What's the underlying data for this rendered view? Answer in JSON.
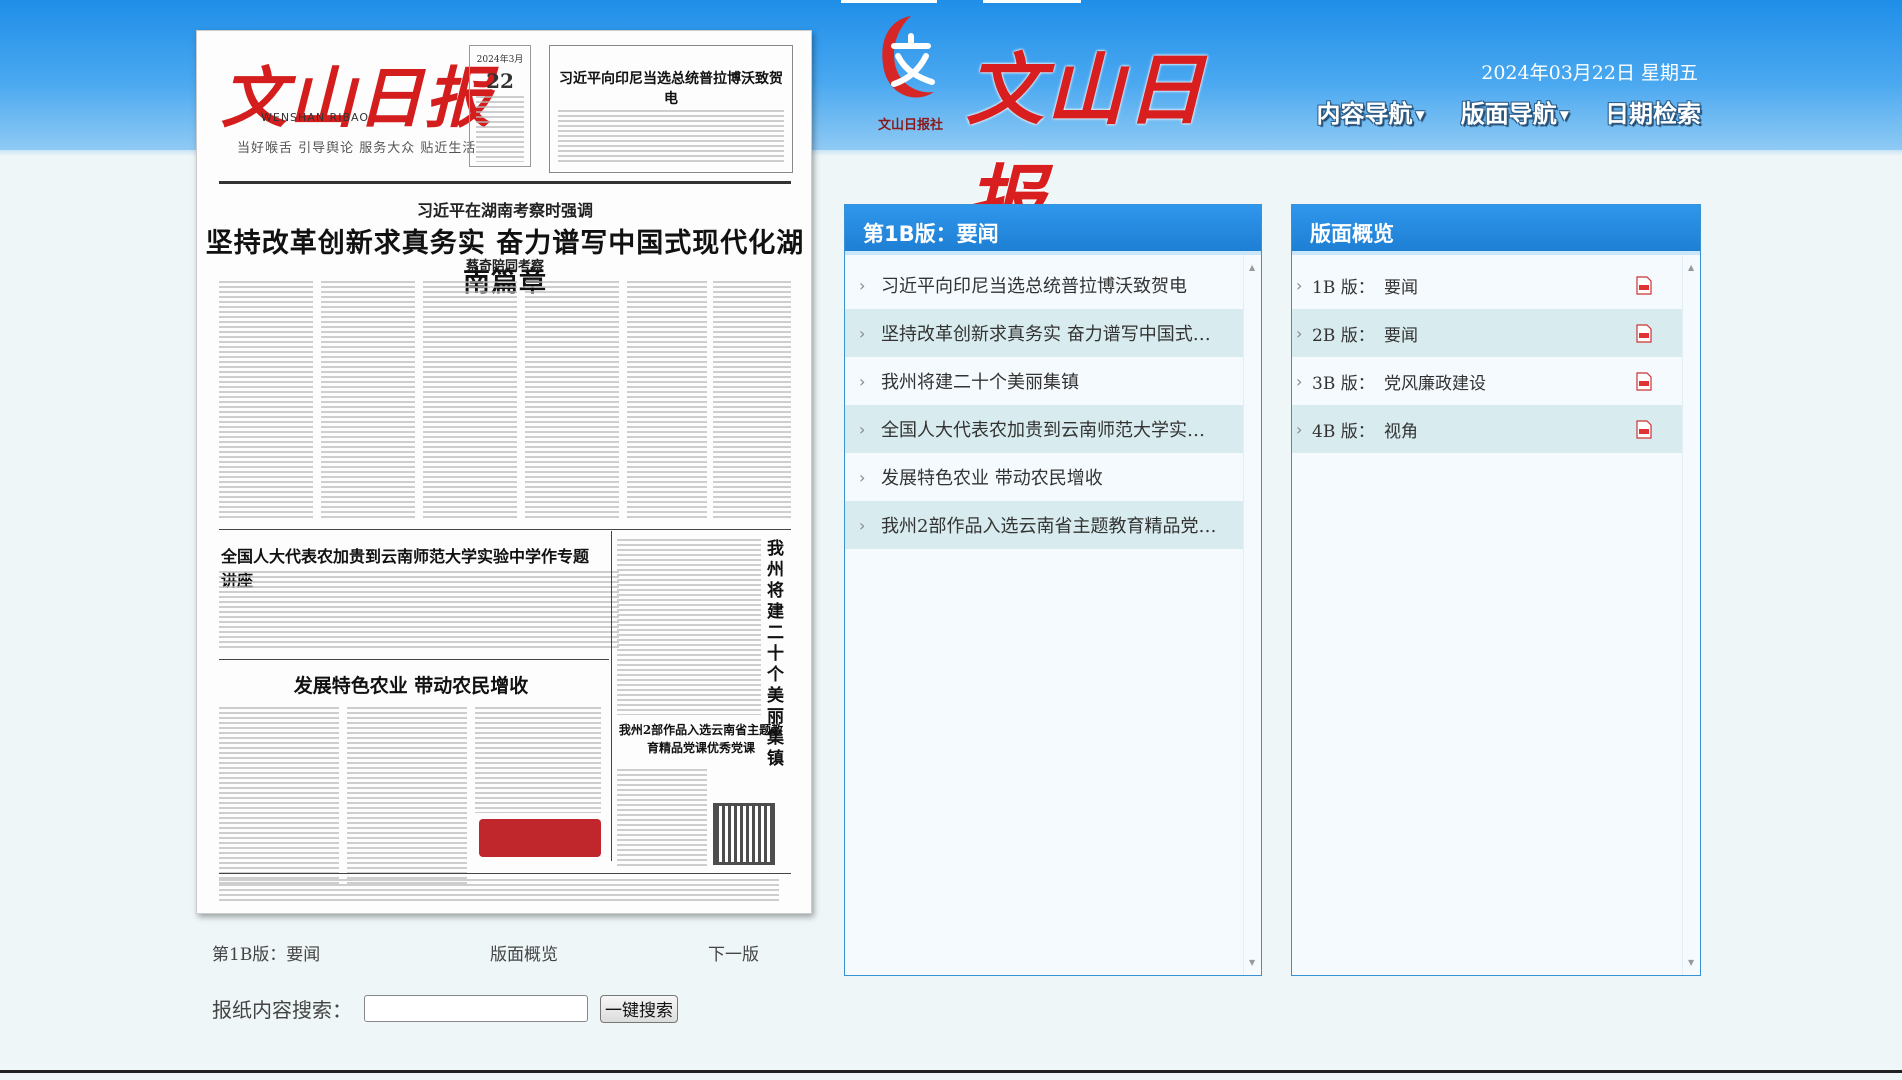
{
  "header": {
    "logo_text": "文山日报",
    "logo_sub": "文山日报社",
    "date": "2024年03月22日  星期五",
    "nav": [
      {
        "label": "内容导航",
        "has_dropdown": true
      },
      {
        "label": "版面导航",
        "has_dropdown": true
      },
      {
        "label": "日期检索",
        "has_dropdown": false
      }
    ]
  },
  "paper": {
    "masthead": "文山日报",
    "pinyin": "WENSHAN RIBAO",
    "slogan": "当好喉舌  引导舆论  服务大众  贴近生活",
    "date_month": "2024年3月",
    "date_day": "22",
    "box_title": "习近平向印尼当选总统普拉博沃致贺电",
    "kicker": "习近平在湖南考察时强调",
    "headline": "坚持改革创新求真务实  奋力谱写中国式现代化湖南篇章",
    "byline": "蔡奇陪同考察",
    "sub1": "全国人大代表农加贵到云南师范大学实验中学作专题讲座",
    "sub2": "发展特色农业  带动农民增收",
    "vertical": "我州将建二十个美丽集镇",
    "sub3": "我州2部作品入选云南省主题教育精品党课优秀党课"
  },
  "paper_links": {
    "current": "第1B版：要闻",
    "overview": "版面概览",
    "next": "下一版"
  },
  "search": {
    "label": "报纸内容搜索：",
    "input_value": "",
    "button": "一键搜索"
  },
  "news_panel": {
    "title": "第1B版：要闻",
    "items": [
      "习近平向印尼当选总统普拉博沃致贺电",
      "坚持改革创新求真务实 奋力谱写中国式…",
      "我州将建二十个美丽集镇",
      "全国人大代表农加贵到云南师范大学实验…",
      "发展特色农业 带动农民增收",
      "我州2部作品入选云南省主题教育精品党…"
    ]
  },
  "pages_panel": {
    "title": "版面概览",
    "items": [
      {
        "num": "1B 版：",
        "name": "要闻"
      },
      {
        "num": "2B 版：",
        "name": "要闻"
      },
      {
        "num": "3B 版：",
        "name": "党风廉政建设"
      },
      {
        "num": "4B 版：",
        "name": "视角"
      }
    ]
  },
  "colors": {
    "header_blue": "#1f8ee8",
    "panel_head": "#2f97ec",
    "brand_red": "#d81e1e",
    "row_alt": "#d8ebee"
  },
  "icons": {
    "nav_caret": "chevron-down-icon",
    "item_marker": "chevron-right-icon",
    "pdf": "pdf-icon"
  }
}
